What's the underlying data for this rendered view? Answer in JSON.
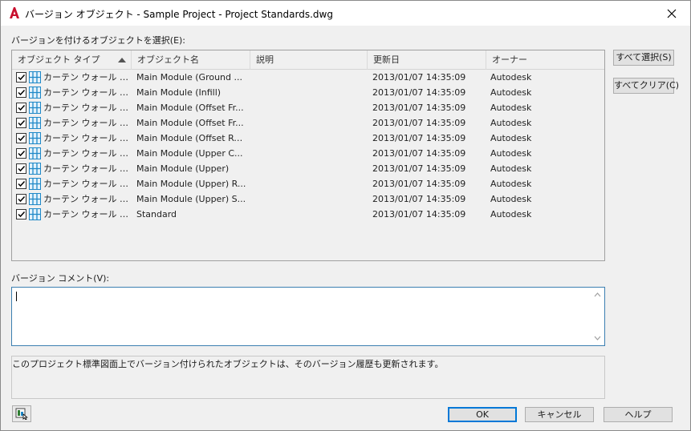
{
  "window": {
    "title": "バージョン オブジェクト - Sample Project - Project Standards.dwg"
  },
  "select_label": "バージョンを付けるオブジェクトを選択(E):",
  "columns": [
    "オブジェクト タイプ",
    "オブジェクト名",
    "説明",
    "更新日",
    "オーナー"
  ],
  "rows": [
    {
      "checked": true,
      "type": "カーテン ウォール スタ...",
      "name": "Main Module (Ground ...",
      "description": "",
      "date": "2013/01/07 14:35:09",
      "owner": "Autodesk"
    },
    {
      "checked": true,
      "type": "カーテン ウォール スタ...",
      "name": "Main Module (Infill)",
      "description": "",
      "date": "2013/01/07 14:35:09",
      "owner": "Autodesk"
    },
    {
      "checked": true,
      "type": "カーテン ウォール スタ...",
      "name": "Main Module (Offset Fr...",
      "description": "",
      "date": "2013/01/07 14:35:09",
      "owner": "Autodesk"
    },
    {
      "checked": true,
      "type": "カーテン ウォール スタ...",
      "name": "Main Module (Offset Fr...",
      "description": "",
      "date": "2013/01/07 14:35:09",
      "owner": "Autodesk"
    },
    {
      "checked": true,
      "type": "カーテン ウォール スタ...",
      "name": "Main Module (Offset Re...",
      "description": "",
      "date": "2013/01/07 14:35:09",
      "owner": "Autodesk"
    },
    {
      "checked": true,
      "type": "カーテン ウォール スタ...",
      "name": "Main Module (Upper C...",
      "description": "",
      "date": "2013/01/07 14:35:09",
      "owner": "Autodesk"
    },
    {
      "checked": true,
      "type": "カーテン ウォール スタ...",
      "name": "Main Module (Upper)",
      "description": "",
      "date": "2013/01/07 14:35:09",
      "owner": "Autodesk"
    },
    {
      "checked": true,
      "type": "カーテン ウォール スタ...",
      "name": "Main Module (Upper) R...",
      "description": "",
      "date": "2013/01/07 14:35:09",
      "owner": "Autodesk"
    },
    {
      "checked": true,
      "type": "カーテン ウォール スタ...",
      "name": "Main Module (Upper) S...",
      "description": "",
      "date": "2013/01/07 14:35:09",
      "owner": "Autodesk"
    },
    {
      "checked": true,
      "type": "カーテン ウォール スタ...",
      "name": "Standard",
      "description": "",
      "date": "2013/01/07 14:35:09",
      "owner": "Autodesk"
    }
  ],
  "buttons": {
    "select_all": "すべて選択(S)",
    "clear_all": "すべてクリア(C)",
    "ok": "OK",
    "cancel": "キャンセル",
    "help": "ヘルプ"
  },
  "comment_label": "バージョン コメント(V):",
  "comment_value": "",
  "info_text": "このプロジェクト標準図面上でバージョン付けられたオブジェクトは、そのバージョン履歴も更新されます。",
  "colors": {
    "brand": "#c8102e",
    "accent": "#0078d7",
    "icon_blue": "#1e88c8"
  },
  "icons": [
    "autocad-logo-icon",
    "close-icon",
    "checkbox-checked-icon",
    "curtain-wall-icon",
    "sort-ascending-icon",
    "scroll-up-icon",
    "scroll-down-icon",
    "display-settings-icon"
  ]
}
